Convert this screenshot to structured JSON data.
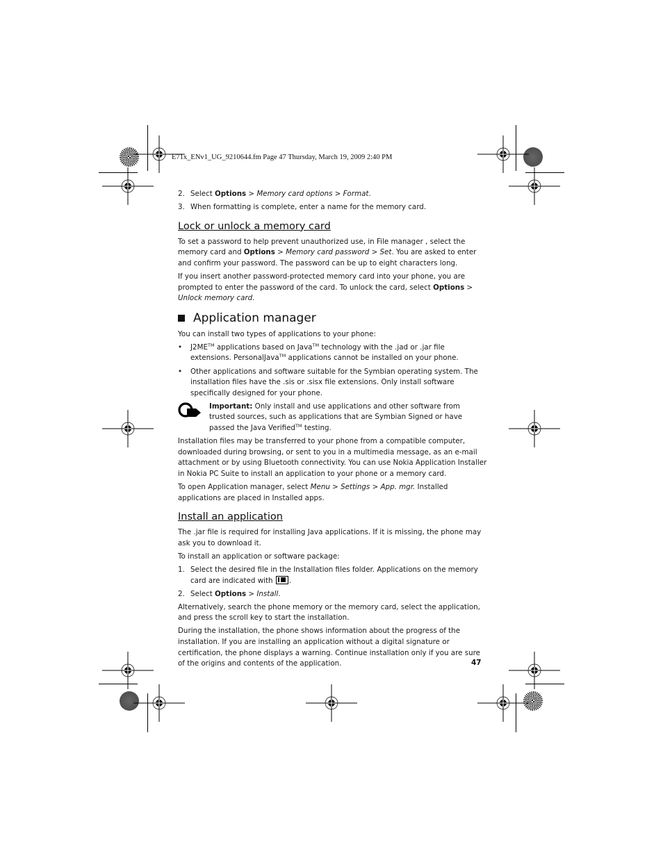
{
  "header": {
    "file_info": "E71x_ENv1_UG_9210644.fm  Page 47  Thursday, March 19, 2009  2:40 PM"
  },
  "steps_top": [
    {
      "num": "2.",
      "pre": "Select ",
      "b1": "Options",
      "sep1": " > ",
      "i1": "Memory card options",
      "sep2": " > ",
      "i2": "Format",
      "post": "."
    },
    {
      "num": "3.",
      "text": "When formatting is complete, enter a name for the memory card."
    }
  ],
  "lock_section": {
    "title": "Lock or unlock a memory card",
    "p1": {
      "a": "To set a password to help prevent unauthorized use, in File manager , select the memory card and ",
      "b1": "Options",
      "sep1": " > ",
      "i1": "Memory card password",
      "sep2": " > ",
      "i2": "Set",
      "c": ". You are asked to enter and confirm your password. The password can be up to eight characters long."
    },
    "p2": {
      "a": "If you insert another password-protected memory card into your phone, you are prompted to enter the password of the card. To unlock the card, select ",
      "b1": "Options",
      "sep1": " > ",
      "i1": "Unlock memory card",
      "c": "."
    }
  },
  "app_manager": {
    "title": "Application manager",
    "intro": "You can install two types of applications to your phone:",
    "bullets": [
      {
        "a": "J2ME",
        "tm1": "TM",
        "b": " applications based on Java",
        "tm2": "TM",
        "c": " technology with the .jad or .jar file extensions. PersonalJava",
        "tm3": "TM",
        "d": " applications cannot be installed on your phone."
      },
      {
        "text": "Other applications and software suitable for the Symbian operating system. The installation files have the .sis or .sisx file extensions. Only install software specifically designed for your phone."
      }
    ],
    "bullet_char": "•",
    "important": {
      "label": "Important:",
      "a": " Only install and use applications and other software from trusted sources, such as applications that are Symbian Signed or have passed the Java Verified",
      "tm": "TM",
      "b": " testing."
    },
    "p_transfer": "Installation files may be transferred to your phone from a compatible computer, downloaded during browsing, or sent to you in a multimedia message, as an e-mail attachment or by using Bluetooth connectivity. You can use Nokia Application Installer in Nokia PC Suite to install an application to your phone or a memory card.",
    "p_open": {
      "a": "To open Application manager, select ",
      "i1": "Menu",
      "sep1": " > ",
      "i2": "Settings",
      "sep2": " > ",
      "i3": "App. mgr.",
      "b": " Installed applications are placed in Installed apps."
    }
  },
  "install_section": {
    "title": "Install an application",
    "p1": "The .jar file is required for installing Java applications. If it is missing, the phone may ask you to download it.",
    "p2": "To install an application or software package:",
    "steps": [
      {
        "num": "1.",
        "a": "Select the desired file in the Installation files folder. Applications on the memory card are indicated with ",
        "icon": "memory-card-icon",
        "b": "."
      },
      {
        "num": "2.",
        "pre": "Select ",
        "b1": "Options",
        "sep1": " > ",
        "i1": "Install",
        "post": "."
      }
    ],
    "p_alt": "Alternatively, search the phone memory or the memory card, select the application, and press the scroll key to start the installation.",
    "p_during": "During the installation, the phone shows information about the progress of the installation. If you are installing an application without a digital signature or certification, the phone displays a warning. Continue installation only if you are sure of the origins and contents of the application."
  },
  "page_number": "47"
}
